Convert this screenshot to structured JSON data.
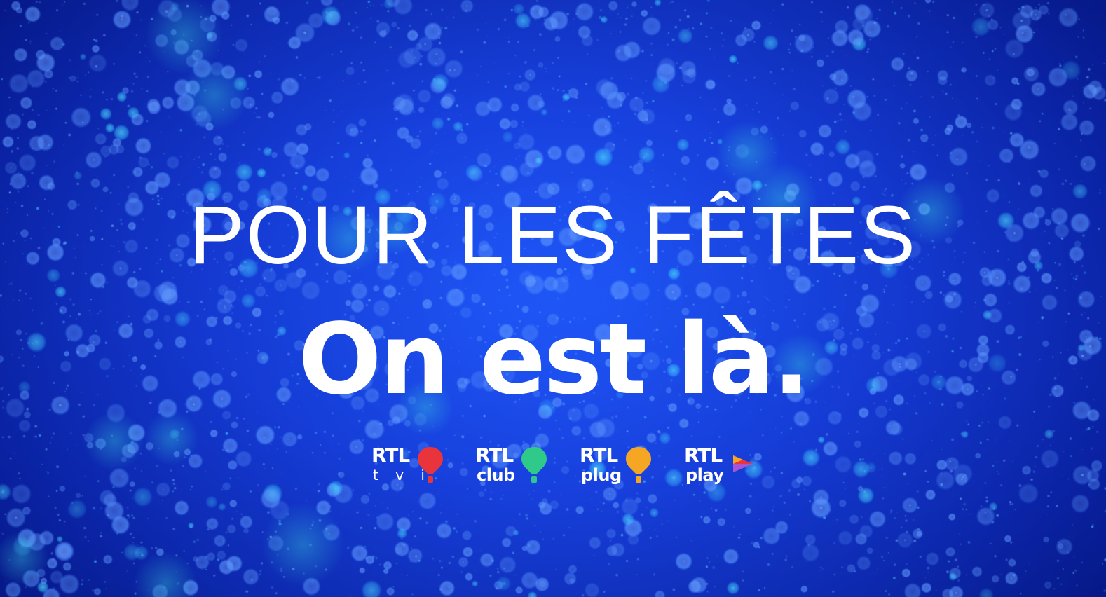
{
  "headline": {
    "line1": "POUR LES FÊTES",
    "line2": "On est là."
  },
  "logos": [
    {
      "brand": "RTL",
      "sub": "t v i",
      "color": "#e8343a",
      "icon": "red-balloon-icon"
    },
    {
      "brand": "RTL",
      "sub": "club",
      "color": "#2fc98a",
      "icon": "green-balloon-icon"
    },
    {
      "brand": "RTL",
      "sub": "plug",
      "color": "#f5a623",
      "icon": "orange-balloon-icon"
    },
    {
      "brand": "RTL",
      "sub": "play",
      "color": "#e8343a",
      "icon": "play-triangle-icon"
    }
  ],
  "colors": {
    "background": "#1438dc",
    "text": "#ffffff"
  }
}
